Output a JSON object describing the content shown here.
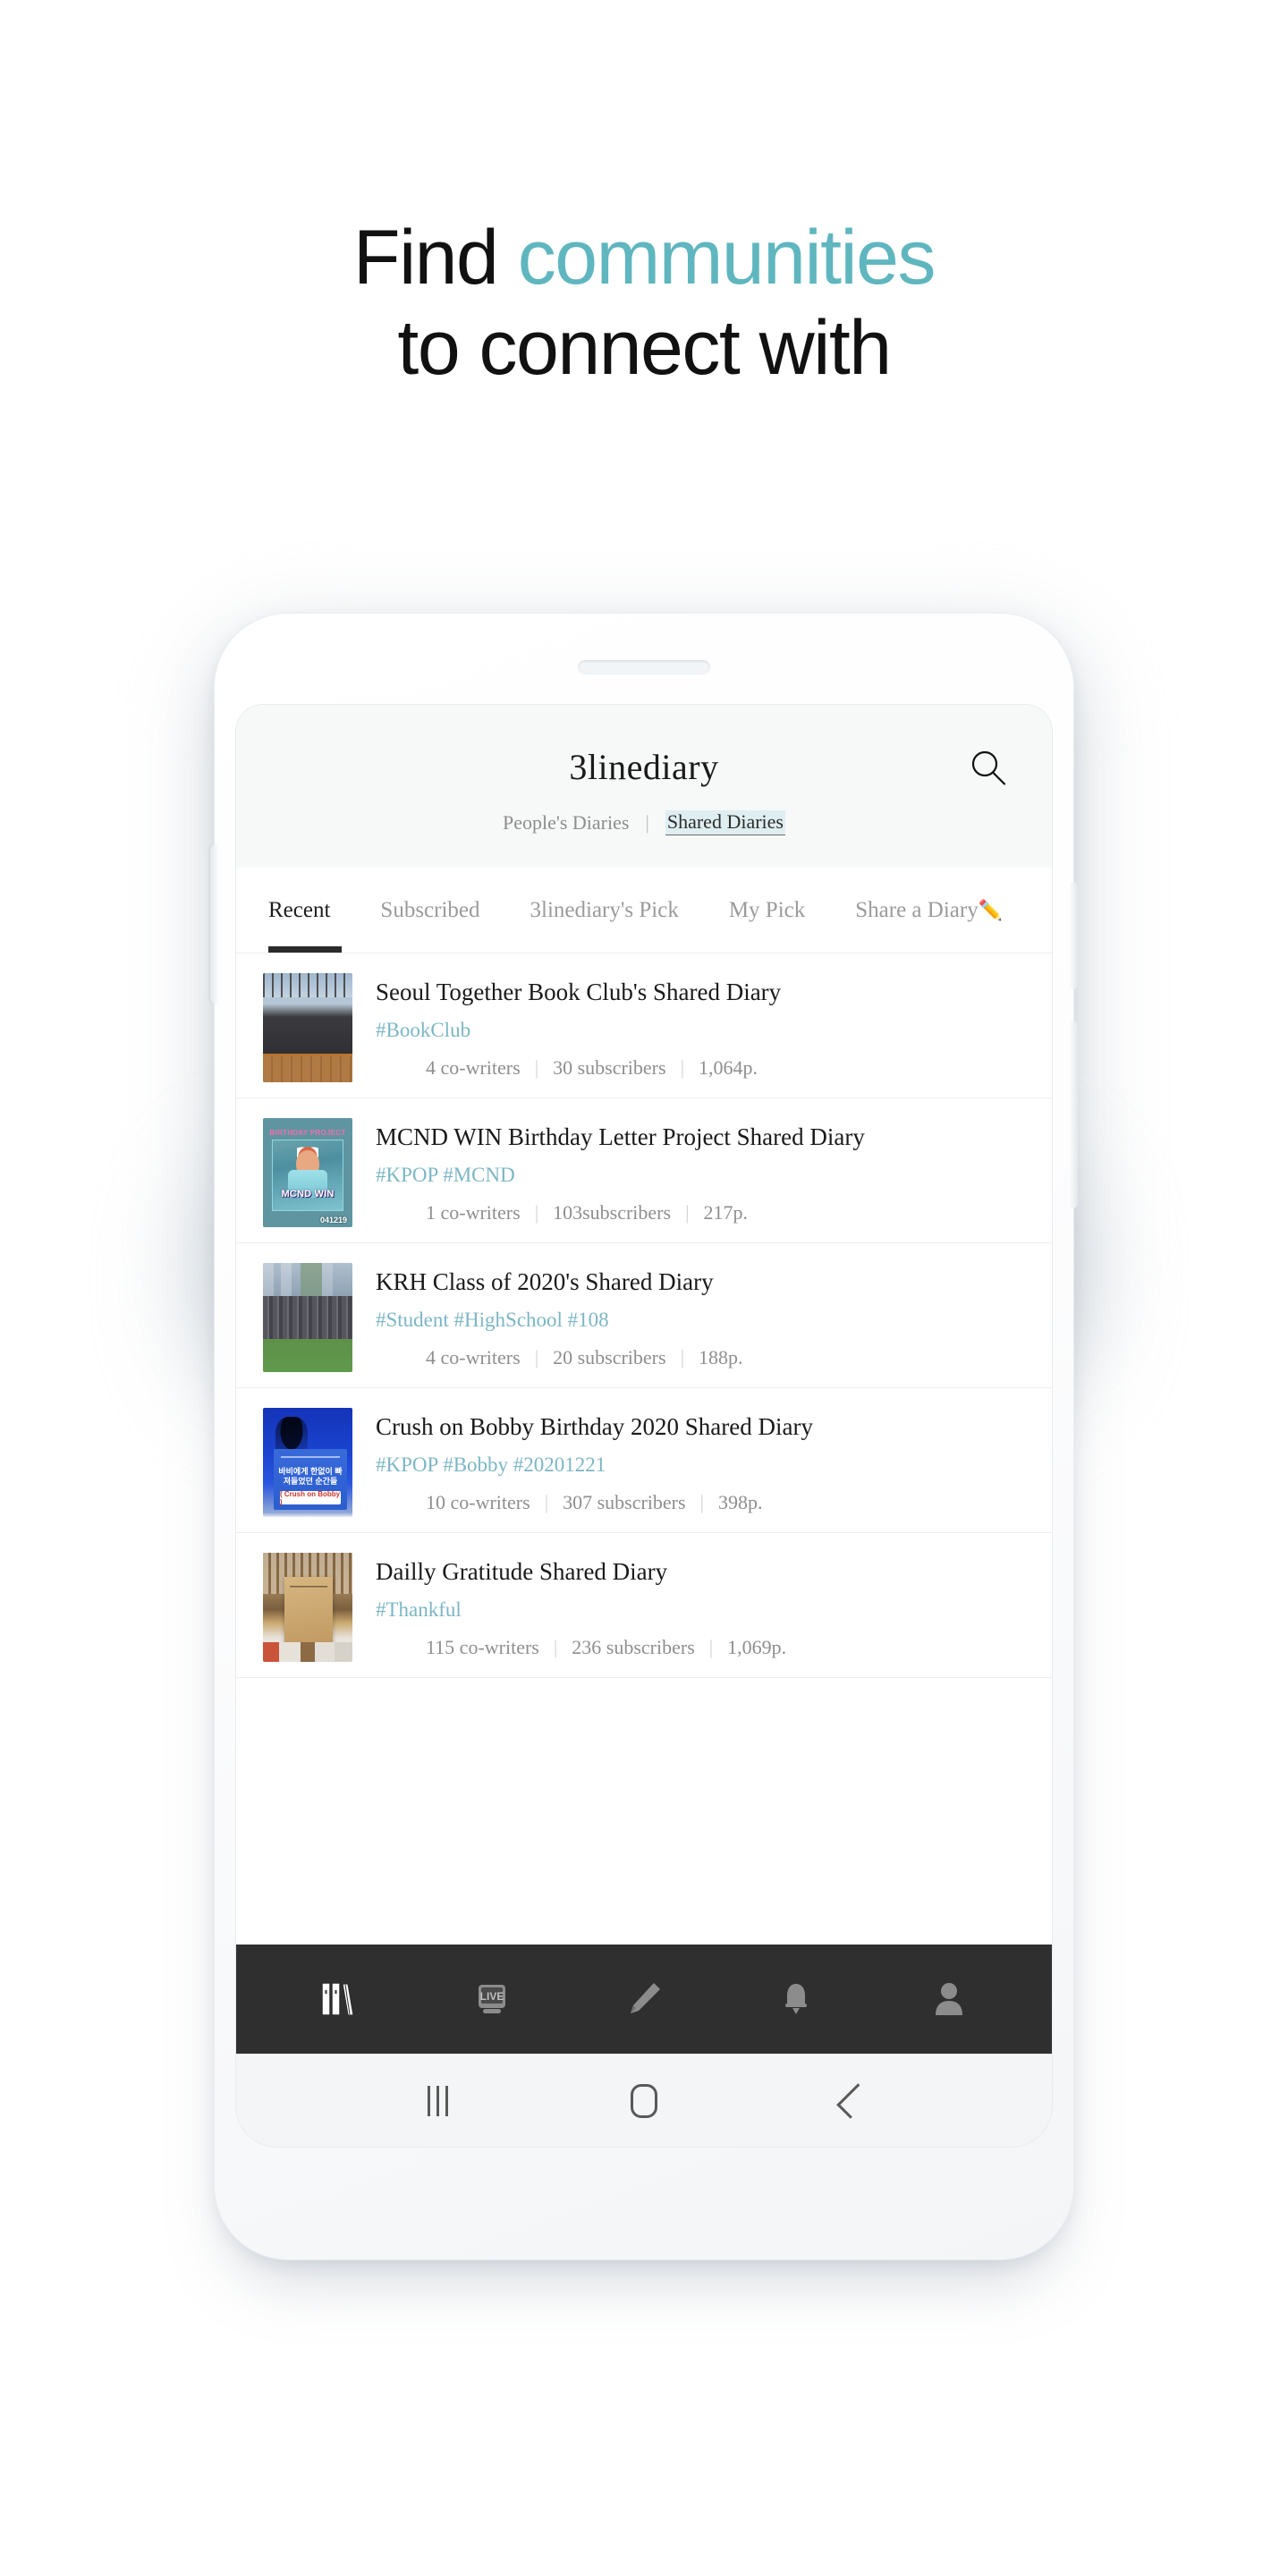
{
  "headline": {
    "line1_pre": "Find ",
    "line1_accent": "communities",
    "line2": "to connect with",
    "accent_color": "#5fb6bf"
  },
  "app": {
    "title": "3linediary",
    "search_icon": "search-icon",
    "sub_tabs": [
      {
        "label": "People's Diaries",
        "active": false
      },
      {
        "label": "|",
        "divider": true
      },
      {
        "label": "Shared Diaries",
        "active": true
      }
    ],
    "tabs": [
      {
        "label": "Recent",
        "active": true
      },
      {
        "label": "Subscribed",
        "active": false
      },
      {
        "label": "3linediary's Pick",
        "active": false
      },
      {
        "label": "My Pick",
        "active": false
      },
      {
        "label": "Share a Diary",
        "active": false,
        "icon": "pencil-icon",
        "glyph": "✏️"
      }
    ],
    "items": [
      {
        "title": "Seoul Together Book Club's Shared Diary",
        "tags": "#BookClub",
        "cowriters": "4 co-writers",
        "subscribers": "30 subscribers",
        "pages": "1,064p.",
        "thumb": "book-club-group-photo"
      },
      {
        "title": "MCND WIN Birthday Letter Project Shared Diary",
        "tags": "#KPOP #MCND",
        "cowriters": "1 co-writers",
        "subscribers": "103subscribers",
        "pages": "217p.",
        "thumb": "mcnd-win-birthday-poster",
        "thumb_text": {
          "header": "BIRTHDAY PROJECT",
          "name": "MCND WIN",
          "date": "041219"
        }
      },
      {
        "title": "KRH Class of 2020's Shared Diary",
        "tags": "#Student #HighSchool #108",
        "cowriters": "4 co-writers",
        "subscribers": "20 subscribers",
        "pages": "188p.",
        "thumb": "krh-class-group-photo"
      },
      {
        "title": "Crush on Bobby Birthday 2020 Shared Diary",
        "tags": "#KPOP #Bobby #20201221",
        "cowriters": "10 co-writers",
        "subscribers": "307 subscribers",
        "pages": "398p.",
        "thumb": "crush-on-bobby-poster",
        "thumb_text": {
          "korean": "바비에게 한없이\n빠져들었던 순간들",
          "pill": "( Crush on Bobby )"
        }
      },
      {
        "title": "Dailly Gratitude Shared Diary",
        "tags": "#Thankful",
        "cowriters": "115 co-writers",
        "subscribers": "236 subscribers",
        "pages": "1,069p.",
        "thumb": "gratitude-bookstore-photo"
      }
    ],
    "meta_separator": "|",
    "bottom_nav": [
      {
        "name": "books-icon",
        "active": true
      },
      {
        "name": "live-icon",
        "label": "LIVE",
        "active": false
      },
      {
        "name": "pencil-icon",
        "active": false
      },
      {
        "name": "bell-icon",
        "active": false
      },
      {
        "name": "person-icon",
        "active": false
      }
    ],
    "nav_active_color": "#ffffff",
    "nav_inactive_color": "#8c8c8c",
    "nav_background": "#2f2f2f"
  },
  "system_nav": [
    {
      "name": "recents-button"
    },
    {
      "name": "home-button"
    },
    {
      "name": "back-button"
    }
  ]
}
